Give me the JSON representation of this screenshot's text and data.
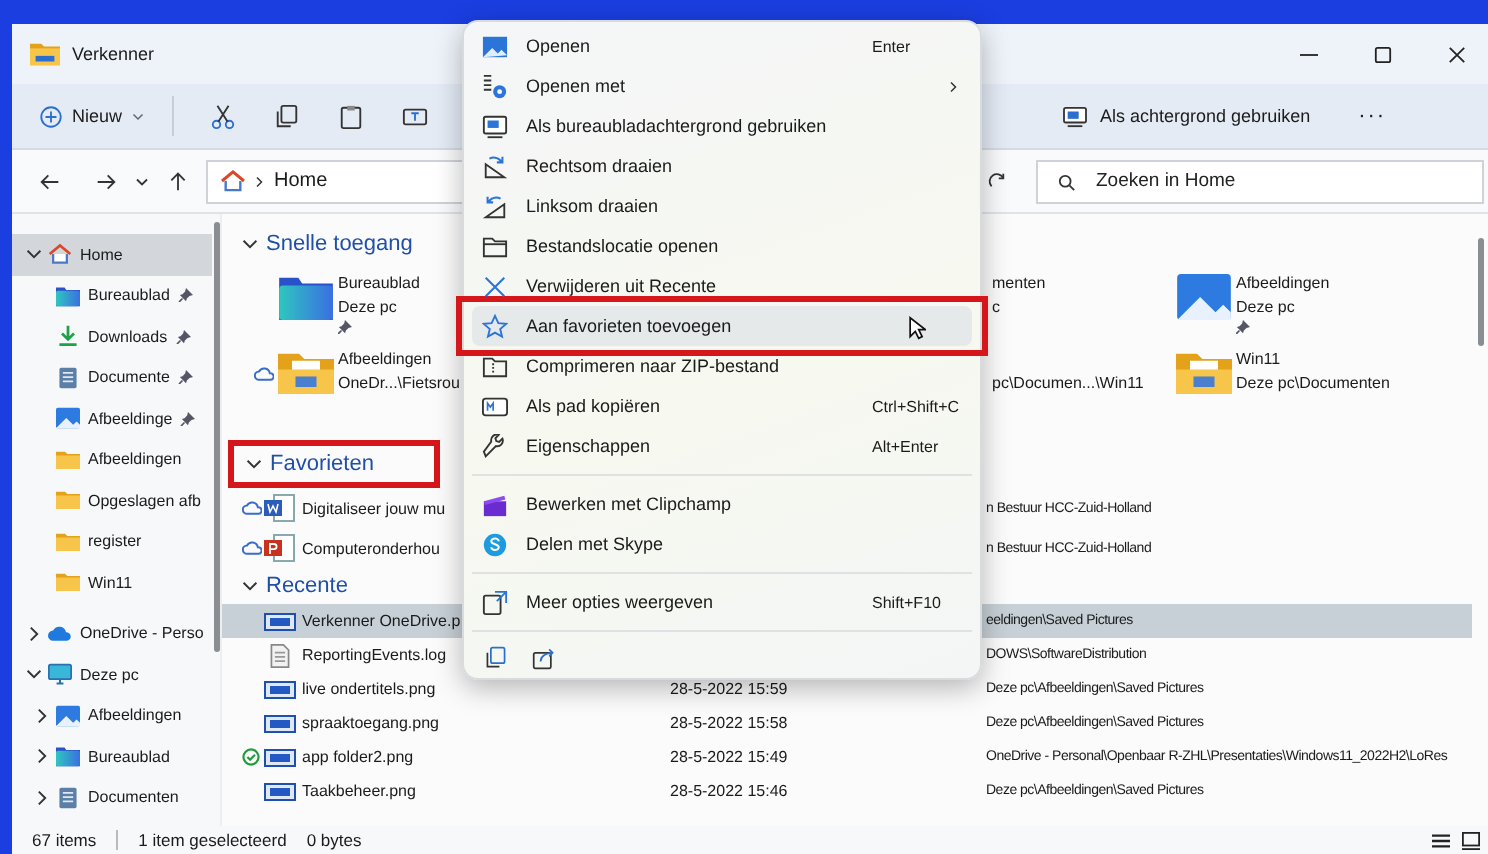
{
  "window": {
    "title": "Verkenner"
  },
  "toolbar": {
    "new_label": "Nieuw",
    "set_background_label": "Als achtergrond gebruiken",
    "more_label": "···"
  },
  "address": {
    "location": "Home"
  },
  "search": {
    "placeholder": "Zoeken in Home"
  },
  "sidebar": {
    "items": [
      {
        "label": "Home",
        "kind": "home",
        "selected": true,
        "expanded": true,
        "children": [
          {
            "label": "Bureaublad",
            "kind": "desktop",
            "selected": false,
            "pinned": true
          },
          {
            "label": "Downloads",
            "kind": "download",
            "selected": false,
            "pinned": true
          },
          {
            "label": "Documente",
            "kind": "documents",
            "selected": false,
            "pinned": true
          },
          {
            "label": "Afbeeldinge",
            "kind": "pictures",
            "selected": false,
            "pinned": true
          },
          {
            "label": "Afbeeldingen",
            "kind": "folder",
            "selected": false,
            "pinned": false
          },
          {
            "label": "Opgeslagen afb",
            "kind": "folder",
            "selected": false,
            "pinned": false
          },
          {
            "label": "register",
            "kind": "folder",
            "selected": false,
            "pinned": false
          },
          {
            "label": "Win11",
            "kind": "folder",
            "selected": false,
            "pinned": false
          }
        ]
      },
      {
        "label": "OneDrive - Perso",
        "kind": "onedrive",
        "selected": false,
        "expanded": false
      },
      {
        "label": "Deze pc",
        "kind": "pc",
        "selected": false,
        "expanded": true,
        "children": [
          {
            "label": "Afbeeldingen",
            "kind": "pictures",
            "selected": false,
            "expanded": false
          },
          {
            "label": "Bureaublad",
            "kind": "desktop",
            "selected": false,
            "expanded": false
          },
          {
            "label": "Documenten",
            "kind": "documents",
            "selected": false,
            "expanded": false
          }
        ]
      }
    ]
  },
  "quick_access": {
    "title": "Snelle toegang",
    "expanded": true,
    "items": [
      {
        "name": "Bureaublad",
        "location": "Deze pc",
        "kind": "desktop",
        "pinned": true,
        "cloud": false
      },
      {
        "name": "menten",
        "location": "c",
        "kind": "covered",
        "pinned": false,
        "cloud": false
      },
      {
        "name": "Afbeeldingen",
        "location": "Deze pc",
        "kind": "pictures",
        "pinned": true,
        "cloud": false
      },
      {
        "name": "Afbeeldingen",
        "location": "OneDr...\\Fietsrou",
        "kind": "folder-image",
        "pinned": false,
        "cloud": true
      },
      {
        "location": "pc\\Documen...\\Win11",
        "kind": "covered",
        "pinned": false,
        "cloud": false
      },
      {
        "name": "Win11",
        "location": "Deze pc\\Documenten",
        "kind": "folder-image",
        "pinned": false,
        "cloud": false
      }
    ]
  },
  "favorites": {
    "title": "Favorieten",
    "expanded": true,
    "highlighted": true,
    "items": [
      {
        "name": "Digitaliseer jouw mu",
        "location": "n Bestuur HCC-Zuid-Holland",
        "kind": "word",
        "cloud": true
      },
      {
        "name": "Computeronderhou",
        "location": "n Bestuur HCC-Zuid-Holland",
        "kind": "powerpoint",
        "cloud": true
      }
    ]
  },
  "recent": {
    "title": "Recente",
    "expanded": true,
    "items": [
      {
        "name": "Verkenner OneDrive.p",
        "location": "eeldingen\\Saved Pictures",
        "kind": "image",
        "selected": true,
        "synced": false
      },
      {
        "name": "ReportingEvents.log",
        "location": "DOWS\\SoftwareDistribution",
        "kind": "log",
        "selected": false,
        "synced": false
      },
      {
        "name": "live ondertitels.png",
        "date": "28-5-2022 15:59",
        "location": "Deze pc\\Afbeeldingen\\Saved Pictures",
        "kind": "image",
        "selected": false,
        "synced": false
      },
      {
        "name": "spraaktoegang.png",
        "date": "28-5-2022 15:58",
        "location": "Deze pc\\Afbeeldingen\\Saved Pictures",
        "kind": "image",
        "selected": false,
        "synced": false
      },
      {
        "name": "app folder2.png",
        "date": "28-5-2022 15:49",
        "location": "OneDrive - Personal\\Openbaar R-ZHL\\Presentaties\\Windows11_2022H2\\LoRes",
        "kind": "image",
        "selected": false,
        "synced": true
      },
      {
        "name": "Taakbeheer.png",
        "date": "28-5-2022 15:46",
        "location": "Deze pc\\Afbeeldingen\\Saved Pictures",
        "kind": "image",
        "selected": false,
        "synced": false
      }
    ]
  },
  "context_menu": {
    "items": [
      {
        "kind": "item",
        "label": "Openen",
        "shortcut": "Enter",
        "submenu": false,
        "selected": false,
        "highlighted": false
      },
      {
        "kind": "item",
        "label": "Openen met",
        "submenu": true,
        "selected": false,
        "highlighted": false
      },
      {
        "kind": "item",
        "label": "Als bureaubladachtergrond gebruiken",
        "submenu": false,
        "selected": false,
        "highlighted": false
      },
      {
        "kind": "item",
        "label": "Rechtsom draaien",
        "submenu": false,
        "selected": false,
        "highlighted": false
      },
      {
        "kind": "item",
        "label": "Linksom draaien",
        "submenu": false,
        "selected": false,
        "highlighted": false
      },
      {
        "kind": "item",
        "label": "Bestandslocatie openen",
        "submenu": false,
        "selected": false,
        "highlighted": false
      },
      {
        "kind": "item",
        "label": "Verwijderen uit Recente",
        "submenu": false,
        "selected": false,
        "highlighted": false
      },
      {
        "kind": "item",
        "label": "Aan favorieten toevoegen",
        "submenu": false,
        "selected": true,
        "highlighted": true
      },
      {
        "kind": "item",
        "label": "Comprimeren naar ZIP-bestand",
        "submenu": false,
        "selected": false,
        "highlighted": false
      },
      {
        "kind": "item",
        "label": "Als pad kopiëren",
        "shortcut": "Ctrl+Shift+C",
        "submenu": false,
        "selected": false,
        "highlighted": false
      },
      {
        "kind": "item",
        "label": "Eigenschappen",
        "shortcut": "Alt+Enter",
        "submenu": false,
        "selected": false,
        "highlighted": false
      },
      {
        "kind": "separator"
      },
      {
        "kind": "item",
        "label": "Bewerken met Clipchamp",
        "submenu": false,
        "selected": false,
        "highlighted": false
      },
      {
        "kind": "item",
        "label": "Delen met Skype",
        "submenu": false,
        "selected": false,
        "highlighted": false
      },
      {
        "kind": "separator"
      },
      {
        "kind": "item",
        "label": "Meer opties weergeven",
        "shortcut": "Shift+F10",
        "submenu": false,
        "selected": false,
        "highlighted": false
      },
      {
        "kind": "separator"
      }
    ]
  },
  "status_bar": {
    "count": "67 items",
    "selection": "1 item geselecteerd",
    "size": "0 bytes"
  }
}
